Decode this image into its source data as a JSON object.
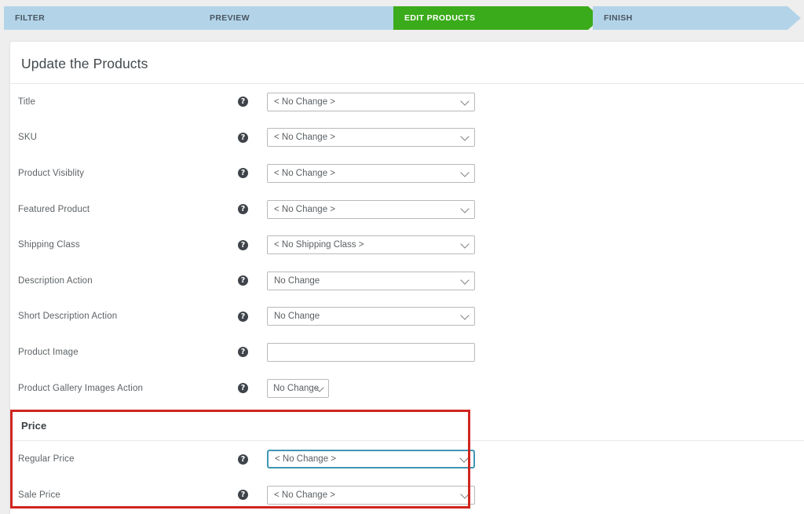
{
  "wizard": {
    "steps": [
      {
        "label": "FILTER",
        "active": false
      },
      {
        "label": "PREVIEW",
        "active": false
      },
      {
        "label": "EDIT PRODUCTS",
        "active": true
      },
      {
        "label": "FINISH",
        "active": false
      }
    ],
    "active_color": "#3aab1a",
    "inactive_color": "#b3d4e8"
  },
  "card": {
    "title": "Update the Products"
  },
  "help_icon_glyph": "?",
  "fields": [
    {
      "label": "Title",
      "control": "select",
      "value": "< No Change >"
    },
    {
      "label": "SKU",
      "control": "select",
      "value": "< No Change >"
    },
    {
      "label": "Product Visiblity",
      "control": "select",
      "value": "< No Change >"
    },
    {
      "label": "Featured Product",
      "control": "select",
      "value": "< No Change >"
    },
    {
      "label": "Shipping Class",
      "control": "select",
      "value": "< No Shipping Class >"
    },
    {
      "label": "Description Action",
      "control": "select",
      "value": "No Change"
    },
    {
      "label": "Short Description Action",
      "control": "select",
      "value": "No Change"
    },
    {
      "label": "Product Image",
      "control": "text",
      "value": "",
      "placeholder": ""
    },
    {
      "label": "Product Gallery Images Action",
      "control": "select-auto",
      "value": "No Change"
    }
  ],
  "price_section": {
    "heading": "Price",
    "highlight_color": "#d0251f",
    "focus_color": "#4096b5",
    "fields": [
      {
        "label": "Regular Price",
        "control": "select",
        "value": "< No Change >",
        "focused": true
      },
      {
        "label": "Sale Price",
        "control": "select",
        "value": "< No Change >",
        "focused": false
      }
    ]
  }
}
